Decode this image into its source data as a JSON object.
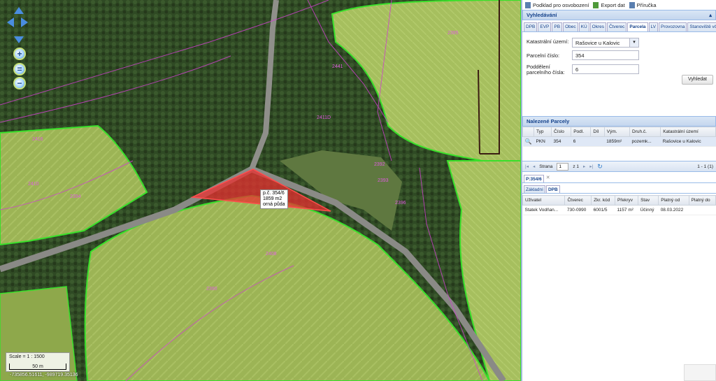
{
  "map": {
    "parcel_popup": {
      "line1": "p.č. 354/6",
      "line2": "1859 m2",
      "line3": "orná půda"
    },
    "scale_text": "Scale = 1 : 1500",
    "scalebar_label": "50 m",
    "coords": "-735856.51611, -989719.35136",
    "parcel_numbers": [
      "2395",
      "2441",
      "2411D",
      "2416",
      "2410",
      "2394",
      "2392",
      "2393",
      "2396",
      "2408",
      "2390"
    ]
  },
  "toolbar": {
    "basemap": "Podklad pro osvobození",
    "export": "Export dat",
    "manual": "Příručka"
  },
  "search": {
    "title": "Vyhledávání",
    "collapse_icon": "double-chevron-up-icon",
    "tabs": [
      "DPB",
      "EVP",
      "PB",
      "Obec",
      "KÚ",
      "Okres",
      "Čtverec",
      "Parcela",
      "LV",
      "Provozovna",
      "Stanoviště včel"
    ],
    "active_tab": "Parcela",
    "cadastral_label": "Katastrální území:",
    "cadastral_value": "Rašovice u Kalovic",
    "parcel_label": "Parcelní číslo:",
    "parcel_value": "354",
    "subdivision_label": "Poddělení parcelního čísla:",
    "subdivision_value": "6",
    "search_button": "Vyhledat"
  },
  "found": {
    "title": "Nalezené Parcely",
    "columns": [
      "Typ",
      "Číslo",
      "Podl.",
      "Díl",
      "Vým.",
      "Druh.č.",
      "Katastrální území"
    ],
    "rows": [
      {
        "typ": "PKN",
        "cislo": "354",
        "podl": "6",
        "dil": "",
        "vym": "1859m²",
        "druh": "pozemk...",
        "ku": "Rašovice u Kalovic"
      }
    ]
  },
  "pager": {
    "page_label": "Strana",
    "page_value": "1",
    "of": "z 1",
    "range": "1 - 1 (1)"
  },
  "detail": {
    "tab_title": "P:354/6",
    "subtabs": [
      "Základní",
      "DPB"
    ],
    "active_subtab": "DPB",
    "columns": [
      "Uživatel",
      "Čtverec",
      "Zkr. kód",
      "Překryv",
      "Stav",
      "Platný od",
      "Platný do"
    ],
    "rows": [
      {
        "uzivatel": "Statek Vodňan...",
        "ctverec": "730-0990",
        "kod": "6001/5",
        "prekryv": "1157 m²",
        "stav": "Účinný",
        "od": "08.03.2022",
        "do": ""
      }
    ]
  },
  "colors": {
    "accent": "#15428b",
    "panel_border": "#99bbe8",
    "parcel_fill": "#e83030",
    "boundary_green": "#39e02a",
    "boundary_pink": "#d040d0"
  }
}
